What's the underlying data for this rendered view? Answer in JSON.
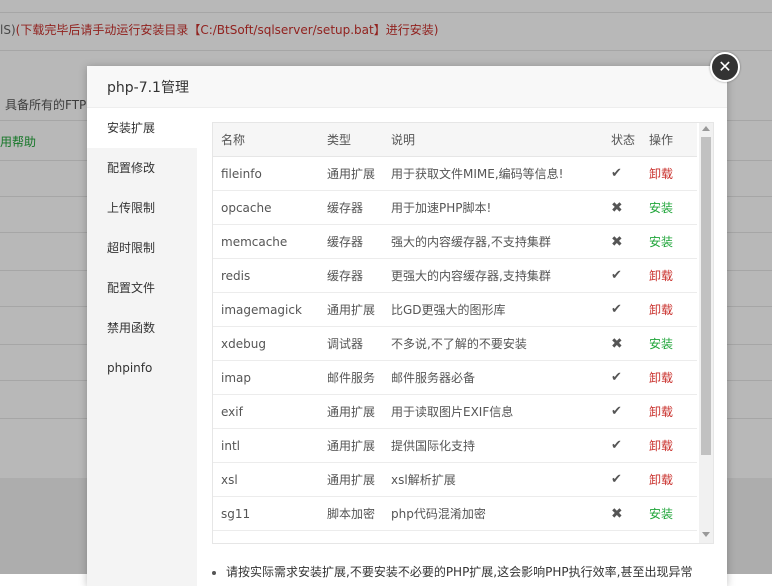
{
  "background": {
    "notice_lead": "lS)",
    "notice_text": "(下载完毕后请手动运行安装目录【C:/BtSoft/sqlserver/setup.bat】进行安装)",
    "ftp_text": "具备所有的FTP",
    "help_link": "用帮助"
  },
  "modal": {
    "title": "php-7.1管理",
    "close_glyph": "✕"
  },
  "nav": {
    "items": [
      {
        "label": "安装扩展"
      },
      {
        "label": "配置修改"
      },
      {
        "label": "上传限制"
      },
      {
        "label": "超时限制"
      },
      {
        "label": "配置文件"
      },
      {
        "label": "禁用函数"
      },
      {
        "label": "phpinfo"
      }
    ],
    "active_index": 0
  },
  "table": {
    "headers": {
      "name": "名称",
      "type": "类型",
      "desc": "说明",
      "status": "状态",
      "action": "操作"
    },
    "rows": [
      {
        "name": "fileinfo",
        "type": "通用扩展",
        "desc": "用于获取文件MIME,编码等信息!",
        "status": "✔",
        "action": "卸载"
      },
      {
        "name": "opcache",
        "type": "缓存器",
        "desc": "用于加速PHP脚本!",
        "status": "✖",
        "action": "安装"
      },
      {
        "name": "memcache",
        "type": "缓存器",
        "desc": "强大的内容缓存器,不支持集群",
        "status": "✖",
        "action": "安装"
      },
      {
        "name": "redis",
        "type": "缓存器",
        "desc": "更强大的内容缓存器,支持集群",
        "status": "✔",
        "action": "卸载"
      },
      {
        "name": "imagemagick",
        "type": "通用扩展",
        "desc": "比GD更强大的图形库",
        "status": "✔",
        "action": "卸载"
      },
      {
        "name": "xdebug",
        "type": "调试器",
        "desc": "不多说,不了解的不要安装",
        "status": "✖",
        "action": "安装"
      },
      {
        "name": "imap",
        "type": "邮件服务",
        "desc": "邮件服务器必备",
        "status": "✔",
        "action": "卸载"
      },
      {
        "name": "exif",
        "type": "通用扩展",
        "desc": "用于读取图片EXIF信息",
        "status": "✔",
        "action": "卸载"
      },
      {
        "name": "intl",
        "type": "通用扩展",
        "desc": "提供国际化支持",
        "status": "✔",
        "action": "卸载"
      },
      {
        "name": "xsl",
        "type": "通用扩展",
        "desc": "xsl解析扩展",
        "status": "✔",
        "action": "卸载"
      },
      {
        "name": "sg11",
        "type": "脚本加密",
        "desc": "php代码混淆加密",
        "status": "✖",
        "action": "安装"
      }
    ]
  },
  "tip": "请按实际需求安装扩展,不要安装不必要的PHP扩展,这会影响PHP执行效率,甚至出现异常",
  "colors": {
    "install": "#20a53a",
    "uninstall": "#c9302c"
  }
}
